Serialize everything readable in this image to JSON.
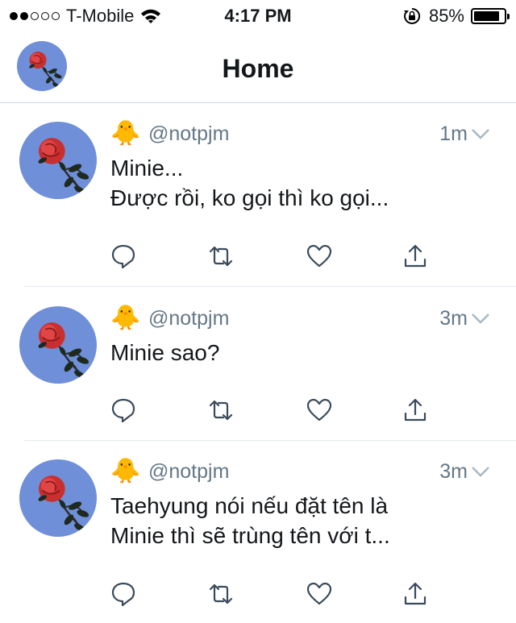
{
  "status_bar": {
    "carrier": "T-Mobile",
    "time": "4:17 PM",
    "battery": "85%",
    "battery_level": 0.85,
    "signal_bars": 2
  },
  "nav": {
    "title": "Home"
  },
  "colors": {
    "secondary_text": "#657786",
    "avatar_bg": "#6f8fd8",
    "rose": "#d63a3a"
  },
  "tweets": [
    {
      "emoji": "🐥",
      "handle": "@notpjm",
      "time": "1m",
      "lines": [
        "Minie...",
        "Được rồi, ko gọi thì ko gọi..."
      ]
    },
    {
      "emoji": "🐥",
      "handle": "@notpjm",
      "time": "3m",
      "lines": [
        "Minie sao?"
      ]
    },
    {
      "emoji": "🐥",
      "handle": "@notpjm",
      "time": "3m",
      "lines": [
        "Taehyung nói nếu đặt tên là",
        "Minie thì sẽ trùng tên với t..."
      ]
    }
  ]
}
